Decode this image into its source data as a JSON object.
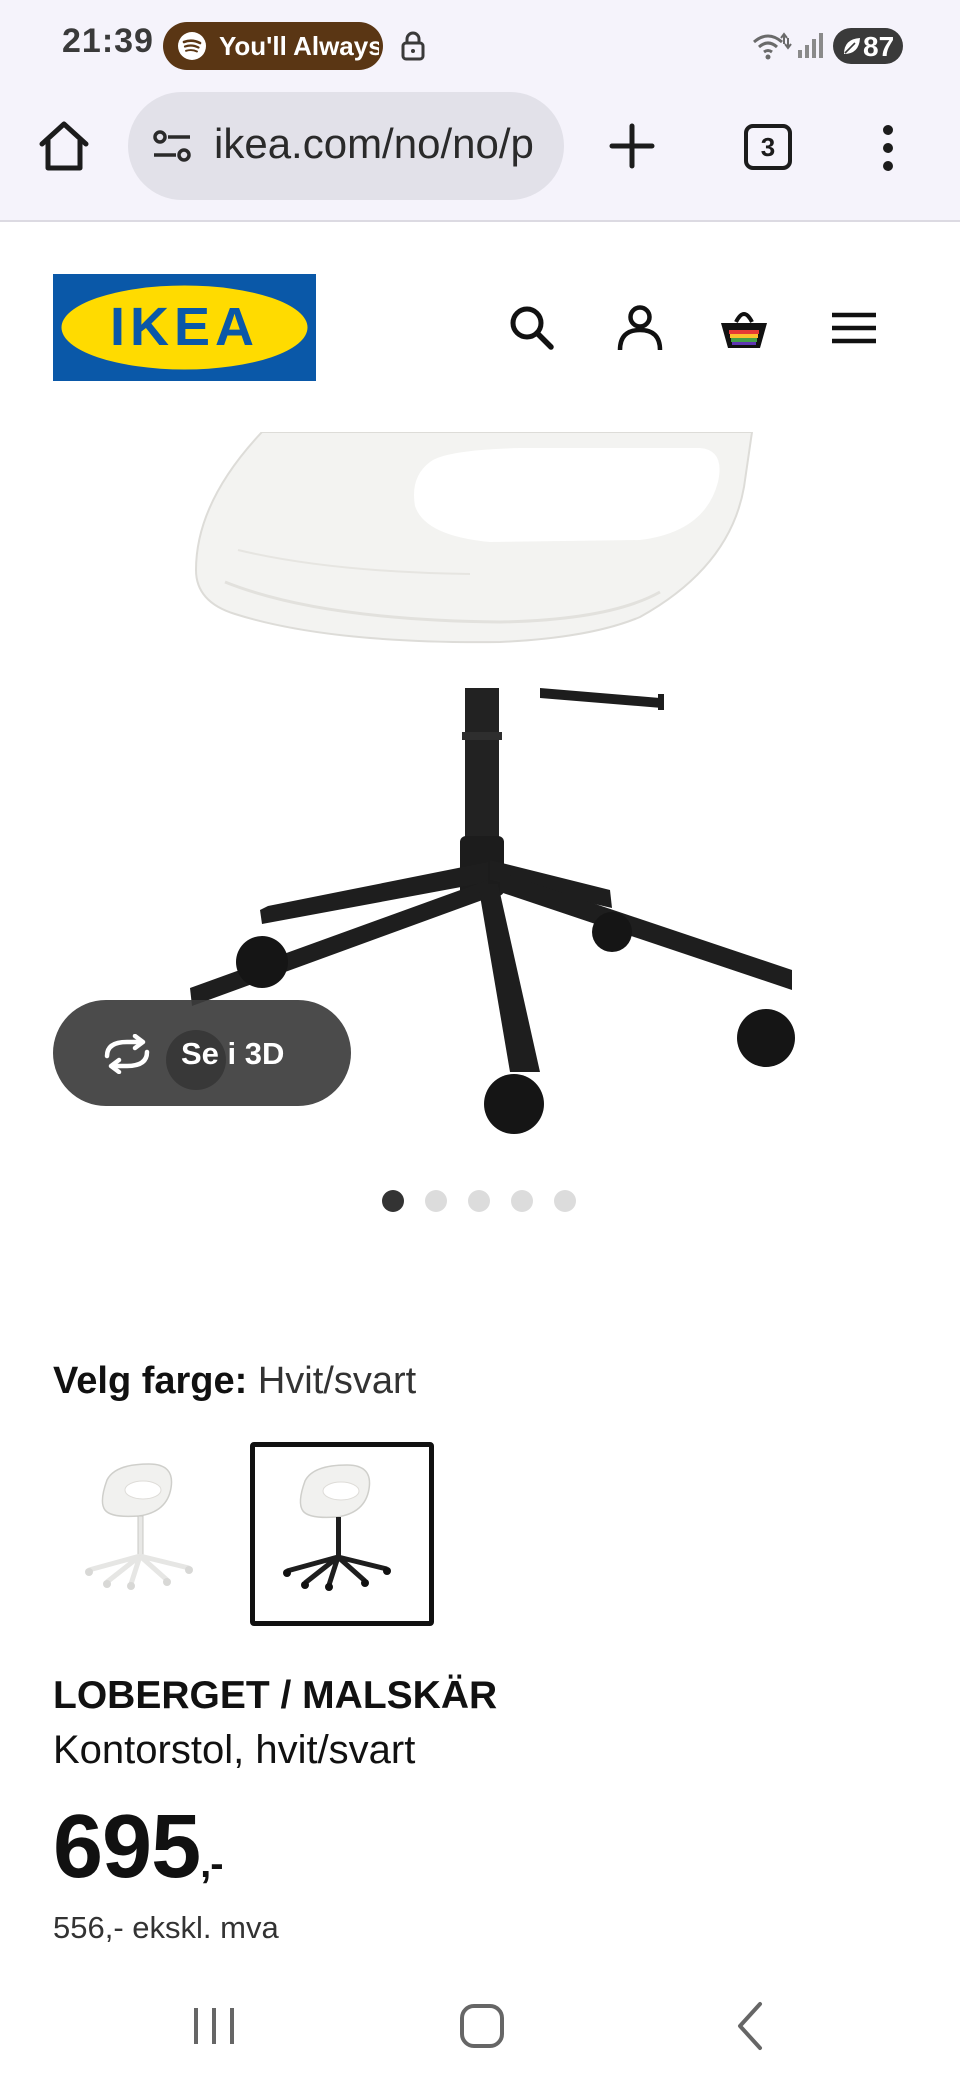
{
  "status_bar": {
    "time": "21:39",
    "media_text": "You'll Always",
    "battery": "87"
  },
  "browser": {
    "url": "ikea.com/no/no/p",
    "tab_count": "3"
  },
  "site": {
    "logo_text": "IKEA",
    "icons": [
      "search-icon",
      "account-icon",
      "basket-icon",
      "hamburger-menu-icon"
    ]
  },
  "gallery": {
    "btn_3d_label": "Se i 3D",
    "image_count": 5,
    "active_index": 0
  },
  "color_select": {
    "label": "Velg farge:",
    "value": "Hvit/svart",
    "options": [
      {
        "name": "white-white",
        "selected": false
      },
      {
        "name": "white-black",
        "selected": true
      }
    ]
  },
  "product": {
    "name": "LOBERGET / MALSKÄR",
    "description": "Kontorstol, hvit/svart",
    "price": "695",
    "price_suffix": ",-",
    "price_ex_vat": "556,- ekskl. mva"
  },
  "colors": {
    "ikea_blue": "#0a58a8",
    "ikea_yellow": "#ffdb00",
    "media_pill": "#5a3614"
  }
}
